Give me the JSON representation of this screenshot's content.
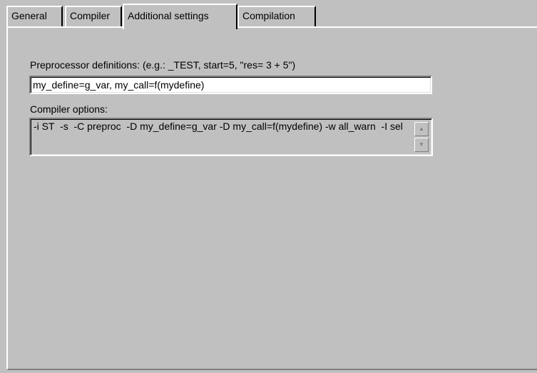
{
  "tabs": [
    {
      "label": "General",
      "active": false
    },
    {
      "label": "Compiler",
      "active": false
    },
    {
      "label": "Additional settings",
      "active": true
    },
    {
      "label": "Compilation",
      "active": false
    }
  ],
  "preprocessor": {
    "label": "Preprocessor definitions: (e.g.: _TEST, start=5, \"res= 3 + 5\")",
    "value": "my_define=g_var, my_call=f(mydefine)"
  },
  "compiler_options": {
    "label": "Compiler options:",
    "value": "-i ST  -s  -C preproc  -D my_define=g_var -D my_call=f(mydefine) -w all_warn  -I sel"
  },
  "icons": {
    "scroll_up": "scroll-up-arrow-icon",
    "scroll_down": "scroll-down-arrow-icon"
  }
}
